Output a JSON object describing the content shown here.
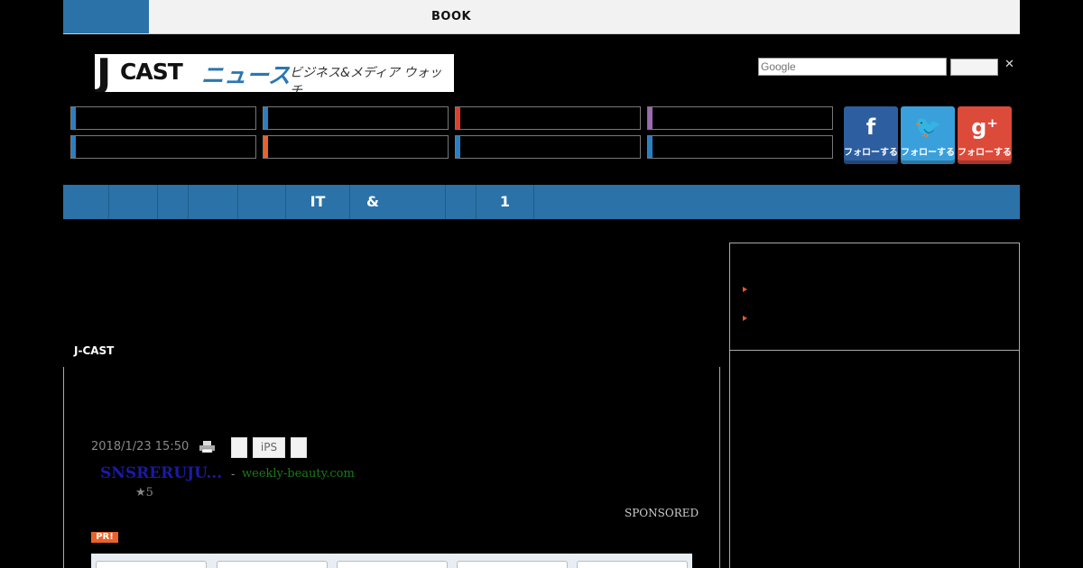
{
  "topbar": {
    "book_label": "BOOK"
  },
  "logo": {
    "j": "J",
    "cast": "CAST",
    "news": "ニュース",
    "subtitle": "ビジネス&メディア ウォッチ"
  },
  "search": {
    "placeholder": "Google",
    "close_symbol": "✕"
  },
  "social": [
    {
      "glyph": "f",
      "label": "フォローする",
      "color": "#2d5fa0"
    },
    {
      "glyph": "🐦",
      "label": "フォローする",
      "color": "#3aa0dc"
    },
    {
      "glyph": "g⁺",
      "label": "フォローする",
      "color": "#dc4a3a"
    }
  ],
  "categories": [
    {
      "color": "#2b7fc0"
    },
    {
      "color": "#2b7fc0"
    },
    {
      "color": "#d9412f"
    },
    {
      "color": "#9a6bb0"
    },
    {
      "color": "#2b7fc0"
    },
    {
      "color": "#e8632b"
    },
    {
      "color": "#2b7fc0"
    },
    {
      "color": "#2b7fc0"
    }
  ],
  "nav": [
    "",
    "",
    "",
    "",
    "",
    "IT",
    "&",
    "",
    "1"
  ],
  "main": {
    "section_label": "J-CAST"
  },
  "article": {
    "date": "2018/1/23 15:50",
    "tags": [
      "",
      "iPS",
      ""
    ]
  },
  "ad": {
    "title": "SNSRERUJU...",
    "separator": "-",
    "domain": "weekly-beauty.com",
    "rating": "★5",
    "sponsored": "SPONSORED",
    "pr_badge": "PR!"
  },
  "colors": {
    "accent": "#2b72a8",
    "pr": "#e8632b"
  }
}
